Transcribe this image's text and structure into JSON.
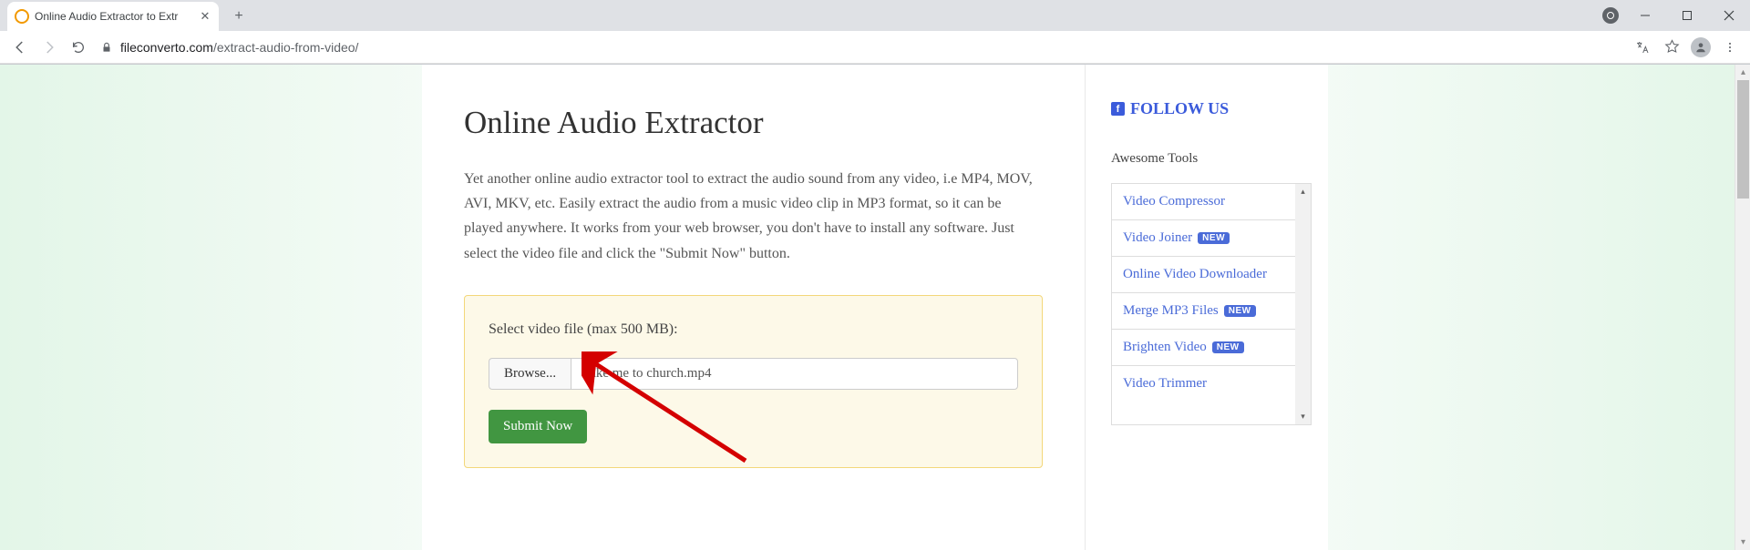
{
  "browser": {
    "tab_title": "Online Audio Extractor to Extr",
    "url_host": "fileconverto.com",
    "url_path": "/extract-audio-from-video/"
  },
  "main": {
    "heading": "Online Audio Extractor",
    "intro": "Yet another online audio extractor tool to extract the audio sound from any video, i.e MP4, MOV, AVI, MKV, etc. Easily extract the audio from a music video clip in MP3 format, so it can be played anywhere. It works from your web browser, you don't have to install any software. Just select the video file and click the \"Submit Now\" button.",
    "upload_label": "Select video file (max 500 MB):",
    "browse_label": "Browse...",
    "file_name": "Take me to church.mp4",
    "submit_label": "Submit Now"
  },
  "sidebar": {
    "follow_label": "FOLLOW US",
    "awesome_label": "Awesome Tools",
    "new_badge": "NEW",
    "tools": [
      {
        "label": "Video Compressor",
        "new": false
      },
      {
        "label": "Video Joiner",
        "new": true
      },
      {
        "label": "Online Video Downloader",
        "new": false
      },
      {
        "label": "Merge MP3 Files",
        "new": true
      },
      {
        "label": "Brighten Video",
        "new": true
      },
      {
        "label": "Video Trimmer",
        "new": false
      }
    ]
  }
}
